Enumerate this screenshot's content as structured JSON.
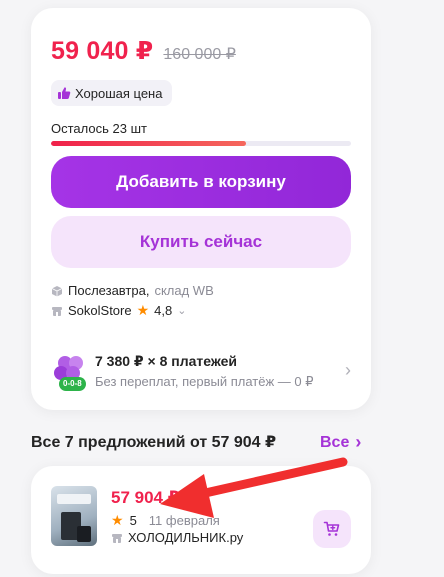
{
  "product": {
    "price": "59 040 ₽",
    "old_price": "160 000 ₽",
    "good_price_label": "Хорошая цена",
    "stock_label": "Осталось 23 шт",
    "stock_fraction": 0.65,
    "add_to_cart_label": "Добавить в корзину",
    "buy_now_label": "Купить сейчас"
  },
  "delivery": {
    "day": "Послезавтра,",
    "warehouse": "склад WB",
    "seller": "SokolStore",
    "rating": "4,8"
  },
  "installment": {
    "title": "7 380 ₽ × 8 платежей",
    "subtitle": "Без переплат, первый платёж — 0 ₽",
    "badge": "0-0-8"
  },
  "offers": {
    "header": "Все 7 предложений от 57 904 ₽",
    "all_label": "Все",
    "items": [
      {
        "price": "57 904 ₽",
        "rating": "5",
        "date": "11 февраля",
        "seller": "ХОЛОДИЛЬНИК.ру"
      }
    ]
  },
  "colors": {
    "price_red": "#f0224d",
    "brand_purple": "#a533d7",
    "arrow_red": "#f02e2e"
  }
}
